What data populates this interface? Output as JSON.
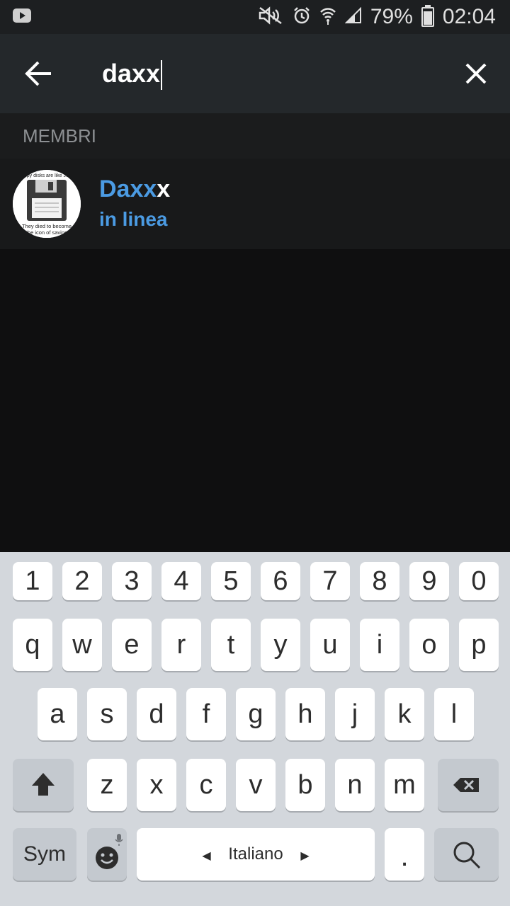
{
  "status_bar": {
    "battery": "79%",
    "time": "02:04"
  },
  "search": {
    "query": "daxx"
  },
  "section": {
    "title": "MEMBRI"
  },
  "results": [
    {
      "name_highlight": "Daxx",
      "name_rest": "x",
      "status": "in linea",
      "avatar_caption_top": "Floppy disks are like Jesus",
      "avatar_caption_bottom1": "They died to become",
      "avatar_caption_bottom2": "the icon of saving"
    }
  ],
  "keyboard": {
    "row_numbers": [
      "1",
      "2",
      "3",
      "4",
      "5",
      "6",
      "7",
      "8",
      "9",
      "0"
    ],
    "row_top": [
      "q",
      "w",
      "e",
      "r",
      "t",
      "y",
      "u",
      "i",
      "o",
      "p"
    ],
    "row_home": [
      "a",
      "s",
      "d",
      "f",
      "g",
      "h",
      "j",
      "k",
      "l"
    ],
    "row_bottom": [
      "z",
      "x",
      "c",
      "v",
      "b",
      "n",
      "m"
    ],
    "sym_label": "Sym",
    "language_label": "Italiano",
    "period_label": "."
  },
  "colors": {
    "accent": "#4b9be3",
    "header_bg": "#24282b",
    "keyboard_bg": "#d3d7dc"
  }
}
